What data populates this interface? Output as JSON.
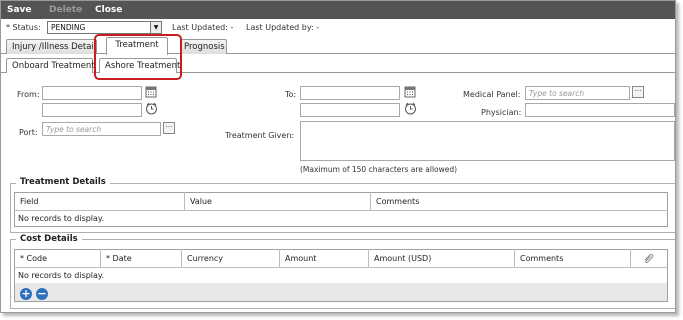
{
  "toolbar": {
    "save": "Save",
    "delete": "Delete",
    "close": "Close"
  },
  "status": {
    "label": "* Status:",
    "value": "PENDING",
    "last_updated": "Last Updated: -",
    "last_updated_by": "Last Updated by: -"
  },
  "tabs": {
    "injury": "Injury /Illness Detail",
    "treatment": "Treatment",
    "prognosis": "Prognosis"
  },
  "subtabs": {
    "onboard": "Onboard Treatment",
    "ashore": "Ashore Treatment"
  },
  "form": {
    "from": "From:",
    "to": "To:",
    "port": "Port:",
    "port_placeholder": "Type to search",
    "medical_panel": "Medical Panel:",
    "medical_placeholder": "Type to search",
    "physician": "Physician:",
    "treatment_given": "Treatment Given:",
    "max_note": "(Maximum of 150 characters are allowed)"
  },
  "treatment_details": {
    "title": "Treatment Details",
    "columns": [
      "Field",
      "Value",
      "Comments"
    ],
    "empty": "No records to display."
  },
  "cost_details": {
    "title": "Cost Details",
    "columns": [
      "* Code",
      "* Date",
      "Currency",
      "Amount",
      "Amount (USD)",
      "Comments"
    ],
    "empty": "No records to display.",
    "add": "+",
    "remove": "−"
  },
  "icons": {
    "calendar": "calendar-icon",
    "clock": "clock-icon",
    "ellipsis": "ellipsis-icon",
    "attachment": "paperclip-icon"
  },
  "colors": {
    "toolbar": "#545454",
    "highlight": "#c81e22",
    "add_button": "#2f6fbf"
  }
}
